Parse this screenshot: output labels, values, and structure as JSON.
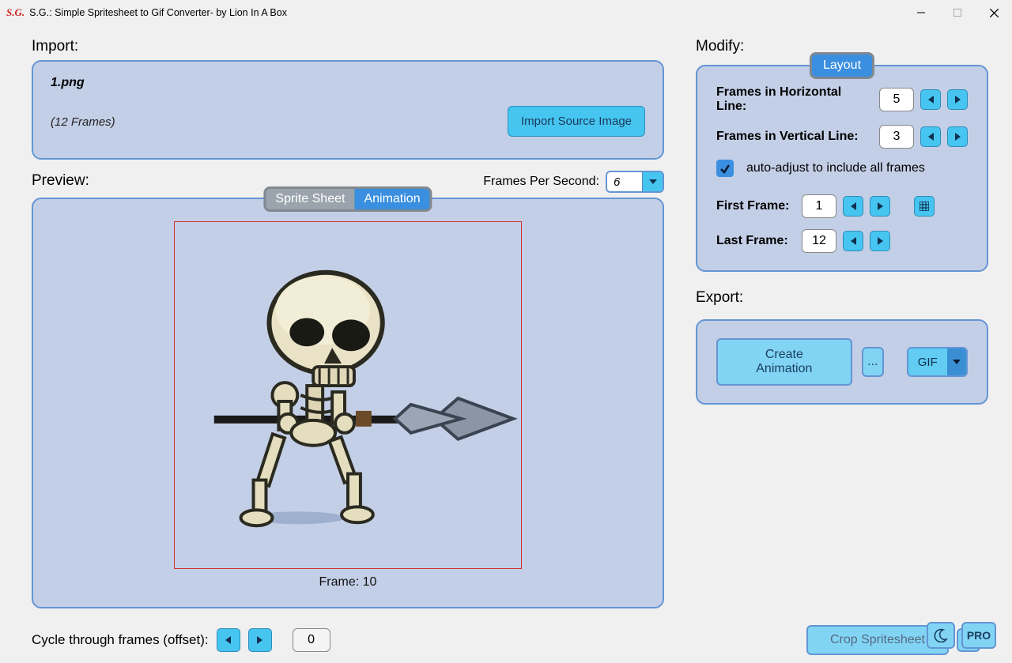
{
  "window": {
    "title": "S.G.: Simple Spritesheet to Gif Converter- by Lion In A Box"
  },
  "import": {
    "section": "Import:",
    "file_name": "1.png",
    "frames_text": "(12 Frames)",
    "button": "Import Source Image"
  },
  "preview": {
    "section": "Preview:",
    "fps_label": "Frames Per Second:",
    "fps_value": "6",
    "tabs": {
      "sheet": "Sprite Sheet",
      "anim": "Animation"
    },
    "frame_label": "Frame: 10"
  },
  "cycle": {
    "label": "Cycle through frames (offset):",
    "value": "0",
    "crop": "Crop Spritesheet",
    "toggle": "↔"
  },
  "bottom_right": {
    "pro": "PRO"
  },
  "modify": {
    "section": "Modify:",
    "layout_badge": "Layout",
    "h_label": "Frames in Horizontal Line:",
    "h_value": "5",
    "v_label": "Frames in Vertical Line:",
    "v_value": "3",
    "auto_label": "auto-adjust to include all frames",
    "first_label": "First Frame:",
    "first_value": "1",
    "last_label": "Last Frame:",
    "last_value": "12"
  },
  "export": {
    "section": "Export:",
    "create": "Create Animation",
    "dots": "...",
    "format": "GIF"
  }
}
